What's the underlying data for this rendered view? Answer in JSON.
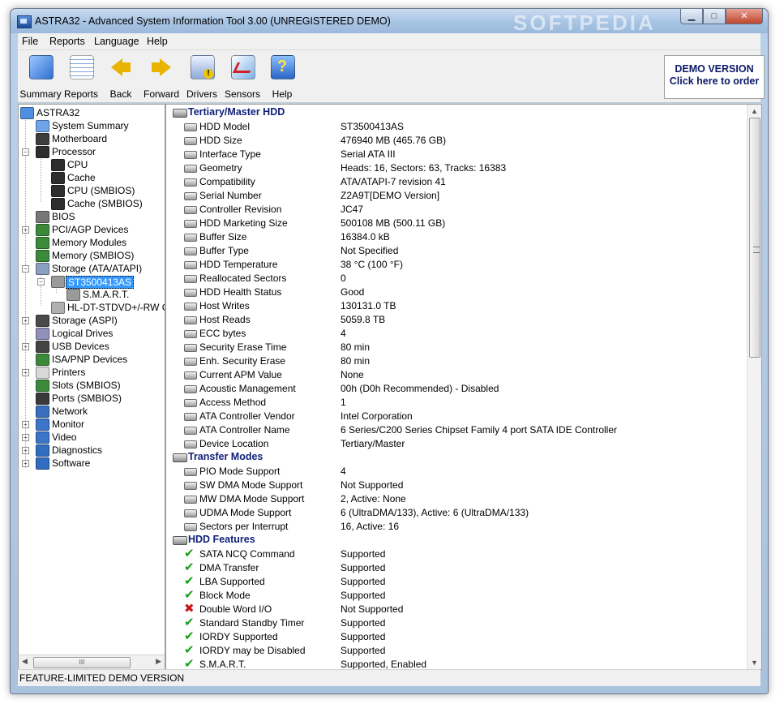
{
  "window": {
    "title": "ASTRA32 - Advanced System Information Tool 3.00 (UNREGISTERED DEMO)",
    "watermark": "SOFTPEDIA",
    "minimize_glyph": "▁",
    "maximize_glyph": "□",
    "close_glyph": "✕"
  },
  "menu": [
    "File",
    "Reports",
    "Language",
    "Help"
  ],
  "toolbar": {
    "buttons": [
      {
        "label": "Summary",
        "icon": "summary-icon"
      },
      {
        "label": "Reports",
        "icon": "reports-icon"
      },
      {
        "label": "Back",
        "icon": "back-arrow-icon"
      },
      {
        "label": "Forward",
        "icon": "forward-arrow-icon"
      },
      {
        "label": "Drivers",
        "icon": "drivers-icon"
      },
      {
        "label": "Sensors",
        "icon": "sensors-icon"
      },
      {
        "label": "Help",
        "icon": "help-icon"
      }
    ],
    "demo_line1": "DEMO VERSION",
    "demo_line2": "Click here to order"
  },
  "tree": {
    "nodes": [
      {
        "label": "ASTRA32",
        "icon": "computer-icon"
      },
      {
        "label": "System Summary",
        "icon": "summary-icon"
      },
      {
        "label": "Motherboard",
        "icon": "motherboard-icon"
      },
      {
        "label": "Processor",
        "icon": "chip-icon"
      },
      {
        "label": "CPU",
        "icon": "chip-icon"
      },
      {
        "label": "Cache",
        "icon": "chip-icon"
      },
      {
        "label": "CPU (SMBIOS)",
        "icon": "chip-icon"
      },
      {
        "label": "Cache (SMBIOS)",
        "icon": "chip-icon"
      },
      {
        "label": "BIOS",
        "icon": "bios-chip-icon"
      },
      {
        "label": "PCI/AGP Devices",
        "icon": "card-icon"
      },
      {
        "label": "Memory Modules",
        "icon": "memory-icon"
      },
      {
        "label": "Memory (SMBIOS)",
        "icon": "memory-icon"
      },
      {
        "label": "Storage (ATA/ATAPI)",
        "icon": "storage-icon"
      },
      {
        "label": "ST3500413AS",
        "icon": "hdd-icon"
      },
      {
        "label": "S.M.A.R.T.",
        "icon": "hdd-icon"
      },
      {
        "label": "HL-DT-STDVD+/-RW G",
        "icon": "dvd-icon"
      },
      {
        "label": "Storage (ASPI)",
        "icon": "storage-icon"
      },
      {
        "label": "Logical Drives",
        "icon": "drive-icon"
      },
      {
        "label": "USB Devices",
        "icon": "usb-icon"
      },
      {
        "label": "ISA/PNP Devices",
        "icon": "card-icon"
      },
      {
        "label": "Printers",
        "icon": "printer-icon"
      },
      {
        "label": "Slots (SMBIOS)",
        "icon": "slot-icon"
      },
      {
        "label": "Ports (SMBIOS)",
        "icon": "port-icon"
      },
      {
        "label": "Network",
        "icon": "network-icon"
      },
      {
        "label": "Monitor",
        "icon": "monitor-icon"
      },
      {
        "label": "Video",
        "icon": "video-icon"
      },
      {
        "label": "Diagnostics",
        "icon": "diagnostics-icon"
      },
      {
        "label": "Software",
        "icon": "software-icon"
      }
    ],
    "scroll_grip": "III"
  },
  "details": {
    "sections": [
      {
        "title": "Tertiary/Master HDD",
        "rows": [
          {
            "name": "HDD Model",
            "value": "ST3500413AS"
          },
          {
            "name": "HDD Size",
            "value": "476940 MB (465.76 GB)"
          },
          {
            "name": "Interface Type",
            "value": "Serial ATA III"
          },
          {
            "name": "Geometry",
            "value": "Heads: 16, Sectors: 63, Tracks: 16383"
          },
          {
            "name": "Compatibility",
            "value": "ATA/ATAPI-7 revision 41"
          },
          {
            "name": "Serial Number",
            "value": "Z2A9T[DEMO Version]"
          },
          {
            "name": "Controller Revision",
            "value": "JC47"
          },
          {
            "name": "HDD Marketing Size",
            "value": "500108 MB (500.11 GB)"
          },
          {
            "name": "Buffer Size",
            "value": "16384.0 kB"
          },
          {
            "name": "Buffer Type",
            "value": "Not Specified"
          },
          {
            "name": "HDD Temperature",
            "value": "38 °C (100 °F)"
          },
          {
            "name": "Reallocated Sectors",
            "value": "0"
          },
          {
            "name": "HDD Health Status",
            "value": "Good"
          },
          {
            "name": "Host Writes",
            "value": "130131.0 TB"
          },
          {
            "name": "Host Reads",
            "value": "5059.8 TB"
          },
          {
            "name": "ECC bytes",
            "value": "4"
          },
          {
            "name": "Security Erase Time",
            "value": "80 min"
          },
          {
            "name": "Enh. Security Erase",
            "value": "80 min"
          },
          {
            "name": "Current APM Value",
            "value": "None"
          },
          {
            "name": "Acoustic Management",
            "value": "00h (D0h Recommended) - Disabled"
          },
          {
            "name": "Access Method",
            "value": "1"
          },
          {
            "name": "ATA Controller Vendor",
            "value": "Intel Corporation"
          },
          {
            "name": "ATA Controller Name",
            "value": "6 Series/C200 Series Chipset Family 4 port SATA IDE Controller"
          },
          {
            "name": "Device Location",
            "value": "Tertiary/Master"
          }
        ]
      },
      {
        "title": "Transfer Modes",
        "rows": [
          {
            "name": "PIO Mode Support",
            "value": "4"
          },
          {
            "name": "SW DMA Mode Support",
            "value": "Not Supported"
          },
          {
            "name": "MW DMA Mode Support",
            "value": "2, Active: None"
          },
          {
            "name": "UDMA Mode Support",
            "value": "6 (UltraDMA/133), Active: 6 (UltraDMA/133)"
          },
          {
            "name": "Sectors per Interrupt",
            "value": "16, Active: 16"
          }
        ]
      },
      {
        "title": "HDD Features",
        "rows": [
          {
            "name": "SATA NCQ Command",
            "value": "Supported",
            "mark": "check"
          },
          {
            "name": "DMA Transfer",
            "value": "Supported",
            "mark": "check"
          },
          {
            "name": "LBA Supported",
            "value": "Supported",
            "mark": "check"
          },
          {
            "name": "Block Mode",
            "value": "Supported",
            "mark": "check"
          },
          {
            "name": "Double Word I/O",
            "value": "Not Supported",
            "mark": "cross"
          },
          {
            "name": "Standard Standby Timer",
            "value": "Supported",
            "mark": "check"
          },
          {
            "name": "IORDY Supported",
            "value": "Supported",
            "mark": "check"
          },
          {
            "name": "IORDY may be Disabled",
            "value": "Supported",
            "mark": "check"
          },
          {
            "name": "S.M.A.R.T.",
            "value": "Supported, Enabled",
            "mark": "check"
          }
        ]
      }
    ]
  },
  "status": {
    "text": "FEATURE-LIMITED DEMO VERSION"
  },
  "colors": {
    "section_title": "#0f1f78",
    "selection": "#3399ff",
    "check": "#18a018",
    "cross": "#c81818"
  }
}
